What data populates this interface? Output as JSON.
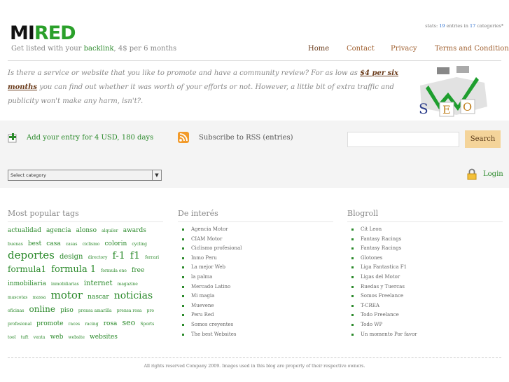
{
  "header": {
    "logo_mi": "MI",
    "logo_red": "RED",
    "tagline_pre": "Get listed with your ",
    "tagline_link": "backlink",
    "tagline_post": ", 4$ per 6 months",
    "stats_pre": "stats: ",
    "stats_entries": "19",
    "stats_mid": " entries in ",
    "stats_categories": "17",
    "stats_post": " categories*"
  },
  "nav": {
    "items": [
      "Home",
      "Contact",
      "Privacy",
      "Terms and Conditions"
    ]
  },
  "intro": {
    "text_pre": "Is there a service or website that you like to promote and have a community review? For as low as ",
    "price": "$4 per six months",
    "text_post": " you can find out whether it was worth of your efforts or not. However, a little bit of extra traffic and publicity won't make any harm, isn't?."
  },
  "seo_image": {
    "label": "SEO"
  },
  "actions": {
    "add_entry": "Add your entry for 4 USD, 180 days",
    "subscribe": "Subscribe to RSS (entries)",
    "search_button": "Search",
    "search_value": "",
    "category_select": "Select category",
    "login": "Login"
  },
  "columns": {
    "tags_title": "Most popular tags",
    "tags": [
      {
        "t": "actualidad",
        "s": 9
      },
      {
        "t": "agencia",
        "s": 9
      },
      {
        "t": "alonso",
        "s": 9
      },
      {
        "t": "alquiler",
        "s": 6
      },
      {
        "t": "awards",
        "s": 9
      },
      {
        "t": "buenas",
        "s": 6
      },
      {
        "t": "best",
        "s": 9
      },
      {
        "t": "casa",
        "s": 9
      },
      {
        "t": "casas",
        "s": 6
      },
      {
        "t": "ciclismo",
        "s": 6
      },
      {
        "t": "colorin",
        "s": 9
      },
      {
        "t": "cycling",
        "s": 6
      },
      {
        "t": "deportes",
        "s": 15
      },
      {
        "t": "design",
        "s": 10
      },
      {
        "t": "directory",
        "s": 6
      },
      {
        "t": "f-1",
        "s": 14
      },
      {
        "t": "f1",
        "s": 14
      },
      {
        "t": "ferrari",
        "s": 6
      },
      {
        "t": "formula1",
        "s": 12
      },
      {
        "t": "formula 1",
        "s": 13
      },
      {
        "t": "formula one",
        "s": 6
      },
      {
        "t": "free",
        "s": 9
      },
      {
        "t": "inmobiliaria",
        "s": 9
      },
      {
        "t": "inmobiliarias",
        "s": 6
      },
      {
        "t": "internet",
        "s": 10
      },
      {
        "t": "magazine",
        "s": 6
      },
      {
        "t": "mascotas",
        "s": 6
      },
      {
        "t": "massa",
        "s": 6
      },
      {
        "t": "motor",
        "s": 15
      },
      {
        "t": "nascar",
        "s": 9
      },
      {
        "t": "noticias",
        "s": 14
      },
      {
        "t": "oficinas",
        "s": 6
      },
      {
        "t": "online",
        "s": 12
      },
      {
        "t": "piso",
        "s": 9
      },
      {
        "t": "prensa amarilla",
        "s": 6
      },
      {
        "t": "prensa rosa",
        "s": 6
      },
      {
        "t": "pro",
        "s": 6
      },
      {
        "t": "profesional",
        "s": 6
      },
      {
        "t": "promote",
        "s": 9
      },
      {
        "t": "races",
        "s": 6
      },
      {
        "t": "racing",
        "s": 6
      },
      {
        "t": "rosa",
        "s": 9
      },
      {
        "t": "seo",
        "s": 11
      },
      {
        "t": "Sports",
        "s": 6
      },
      {
        "t": "tool",
        "s": 6
      },
      {
        "t": "tuft",
        "s": 6
      },
      {
        "t": "venta",
        "s": 6
      },
      {
        "t": "web",
        "s": 9
      },
      {
        "t": "website",
        "s": 6
      },
      {
        "t": "websites",
        "s": 9
      }
    ],
    "interes_title": "De interés",
    "interes": [
      "Agencia Motor",
      "CIAM Motor",
      "Ciclismo profesional",
      "Inmo Peru",
      "La mejor Web",
      "la palma",
      "Mercado Latino",
      "Mi magia",
      "Muevene",
      "Peru Red",
      "Somos creyentes",
      "The best Websites"
    ],
    "blogroll_title": "Blogroll",
    "blogroll": [
      "Cit Leon",
      "Fantasy Racings",
      "Fantasy Racings",
      "Glotones",
      "Liga Fantastica F1",
      "Ligas del Motor",
      "Ruedas y Tuercas",
      "Somos Freelance",
      "T-CREA",
      "Todo Freelance",
      "Todo WP",
      "Un momento Por favor"
    ]
  },
  "footer": {
    "text": "All rights reserved Company 2009. Images used in this blog are property of their respective owners."
  },
  "colors": {
    "accent": "#2b8a2b",
    "nav": "#a06030",
    "button": "#f4d49a"
  }
}
